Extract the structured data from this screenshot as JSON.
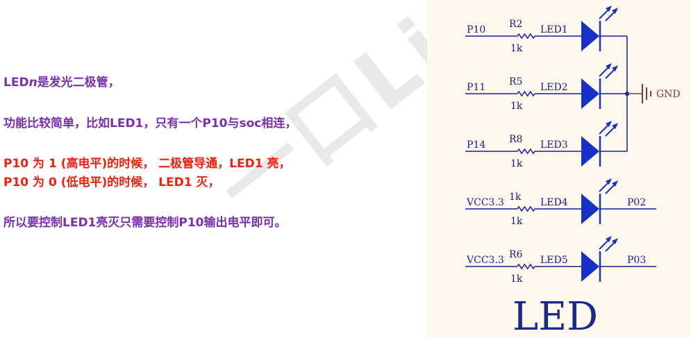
{
  "text": {
    "line1_prefix": "LED",
    "line1_italic": "n",
    "line1_suffix": "是发光二极管，",
    "line2": "功能比较简单，比如LED1，只有一个P10与soc相连，",
    "line3": "P10 为 1 (高电平)的时候， 二极管导通，LED1 亮，",
    "line4": "P10 为 0 (低电平)的时候， LED1 灭，",
    "line5": "所以要控制LED1亮灭只需要控制P10输出电平即可。"
  },
  "colors": {
    "purple": "#7a2fae",
    "red": "#f0200e",
    "wire": "#1a1a9a",
    "led_fill": "#1730c8",
    "gnd": "#7a3b3b"
  },
  "schematic": {
    "title": "LED",
    "gnd_label": "GND",
    "rows": [
      {
        "net": "P10",
        "resistor": "R2",
        "value": "1k",
        "led": "LED1",
        "right_net": ""
      },
      {
        "net": "P11",
        "resistor": "R5",
        "value": "1k",
        "led": "LED2",
        "right_net": ""
      },
      {
        "net": "P14",
        "resistor": "R8",
        "value": "1k",
        "led": "LED3",
        "right_net": ""
      },
      {
        "net": "VCC3.3",
        "resistor": "1k",
        "value": "1k",
        "led": "LED4",
        "right_net": "P02"
      },
      {
        "net": "VCC3.3",
        "resistor": "R6",
        "value": "1k",
        "led": "LED5",
        "right_net": "P03"
      }
    ]
  }
}
